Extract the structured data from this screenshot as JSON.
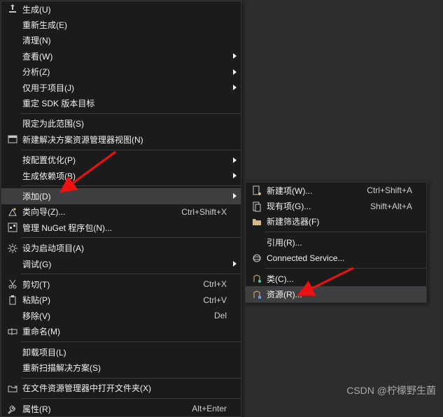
{
  "menu_main": {
    "groups": [
      [
        {
          "icon": "build",
          "label": "生成(U)"
        },
        {
          "icon": "",
          "label": "重新生成(E)"
        },
        {
          "icon": "",
          "label": "清理(N)"
        },
        {
          "icon": "",
          "label": "查看(W)",
          "submenu": true
        },
        {
          "icon": "",
          "label": "分析(Z)",
          "submenu": true
        },
        {
          "icon": "",
          "label": "仅用于项目(J)",
          "submenu": true
        },
        {
          "icon": "",
          "label": "重定 SDK 版本目标"
        }
      ],
      [
        {
          "icon": "",
          "label": "限定为此范围(S)"
        },
        {
          "icon": "new-view",
          "label": "新建解决方案资源管理器视图(N)"
        }
      ],
      [
        {
          "icon": "",
          "label": "按配置优化(P)",
          "submenu": true
        },
        {
          "icon": "",
          "label": "生成依赖项(B)",
          "submenu": true
        }
      ],
      [
        {
          "icon": "",
          "label": "添加(D)",
          "submenu": true,
          "hover": true
        },
        {
          "icon": "class-wizard",
          "label": "类向导(Z)...",
          "shortcut": "Ctrl+Shift+X"
        },
        {
          "icon": "nuget",
          "label": "管理 NuGet 程序包(N)..."
        }
      ],
      [
        {
          "icon": "gear",
          "label": "设为启动项目(A)"
        },
        {
          "icon": "",
          "label": "调试(G)",
          "submenu": true
        }
      ],
      [
        {
          "icon": "cut",
          "label": "剪切(T)",
          "shortcut": "Ctrl+X"
        },
        {
          "icon": "paste",
          "label": "粘贴(P)",
          "shortcut": "Ctrl+V"
        },
        {
          "icon": "",
          "label": "移除(V)",
          "shortcut": "Del"
        },
        {
          "icon": "rename",
          "label": "重命名(M)"
        }
      ],
      [
        {
          "icon": "",
          "label": "卸载项目(L)"
        },
        {
          "icon": "",
          "label": "重新扫描解决方案(S)"
        }
      ],
      [
        {
          "icon": "open-folder",
          "label": "在文件资源管理器中打开文件夹(X)"
        }
      ],
      [
        {
          "icon": "wrench",
          "label": "属性(R)",
          "shortcut": "Alt+Enter"
        }
      ]
    ]
  },
  "menu_sub": {
    "groups": [
      [
        {
          "icon": "new-item",
          "label": "新建项(W)...",
          "shortcut": "Ctrl+Shift+A"
        },
        {
          "icon": "existing-item",
          "label": "现有项(G)...",
          "shortcut": "Shift+Alt+A"
        },
        {
          "icon": "new-filter",
          "label": "新建筛选器(F)"
        }
      ],
      [
        {
          "icon": "",
          "label": "引用(R)..."
        },
        {
          "icon": "connected",
          "label": "Connected Service..."
        }
      ],
      [
        {
          "icon": "class",
          "label": "类(C)..."
        },
        {
          "icon": "resource",
          "label": "资源(R)...",
          "hover": true
        }
      ]
    ]
  },
  "watermark": "CSDN @柠檬野生菌"
}
